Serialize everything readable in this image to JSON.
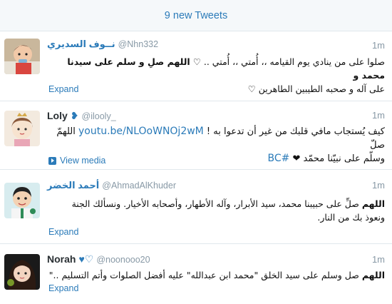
{
  "banner": {
    "label": "9 new Tweets"
  },
  "tweets": [
    {
      "name": "نــوف السديري",
      "handle": "@Nhn332",
      "time": "1m",
      "text_part1": "صلوا على من ينادي يوم القيامه ،، أُمتي ،، أُمتي .. ♡ ",
      "text_bold": "اللهم صلِ و سلم على سيدنا محمد و",
      "text_line2": "على آله و صحبه الطيبين الطاهرين ♡",
      "action": "Expand"
    },
    {
      "name": "Loly",
      "name_icon": "heart-icon",
      "handle": "@ilooly_",
      "time": "1m",
      "text_part1": "كيف يُستجاب مافي قلبك من غير أن تدعوا به ! ",
      "link": "youtu.be/NLOoWNOj2wM",
      "text_part2": " اللهمّ صلّ",
      "text_line2_a": "وسلّم على نبيّنا محمّد ❤ ",
      "hashtag": "#BC",
      "action": "View media"
    },
    {
      "name": "أحمد الخضر",
      "handle": "@AhmadAlKhuder",
      "time": "1m",
      "text_bold": "اللهم",
      "text_part1": " صلِّ على حبيبنا محمد، سيد الأبرار، وآله الأطهار، وأصحابه الأخيار. ونسألك الجنة",
      "text_line2": "ونعوذ بك من النار.",
      "action": "Expand"
    },
    {
      "name": "Norah",
      "name_suffix": "♥♡",
      "handle": "@noonooo20",
      "time": "1m",
      "text_bold": "اللهم",
      "text_part1": " صل وسلم على سيد الخلق \"محمد ابن عبدالله\" عليه أفضل الصلوات وأتم التسليم ..\"",
      "action": "Expand"
    }
  ],
  "colors": {
    "link": "#2b7bb9",
    "meta": "#8899a6",
    "border": "#e1e8ed"
  }
}
